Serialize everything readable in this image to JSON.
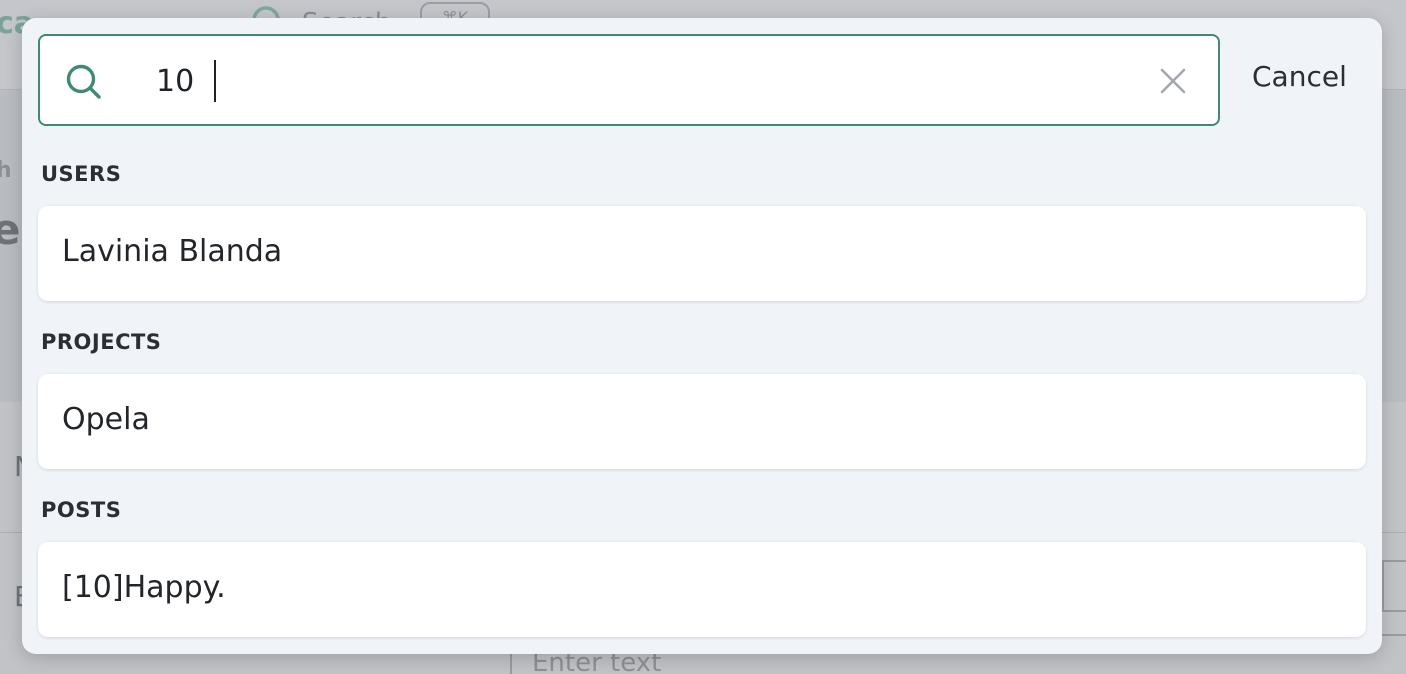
{
  "background": {
    "logo_text": "ca",
    "search_placeholder": "Search",
    "shortcut": "⌘K",
    "breadcrumb": "h",
    "title": "e",
    "row1_label": "N",
    "row2_label": "E",
    "editor_placeholder": "Enter text"
  },
  "search": {
    "value": "10",
    "cancel_label": "Cancel"
  },
  "sections": {
    "users": {
      "label": "USERS",
      "items": [
        "Lavinia Blanda"
      ]
    },
    "projects": {
      "label": "PROJECTS",
      "items": [
        "Opela"
      ]
    },
    "posts": {
      "label": "POSTS",
      "items": [
        "[10]Happy."
      ]
    }
  },
  "colors": {
    "accent": "#3f8a72",
    "modal_bg": "#f0f4f8",
    "card_bg": "#ffffff"
  }
}
